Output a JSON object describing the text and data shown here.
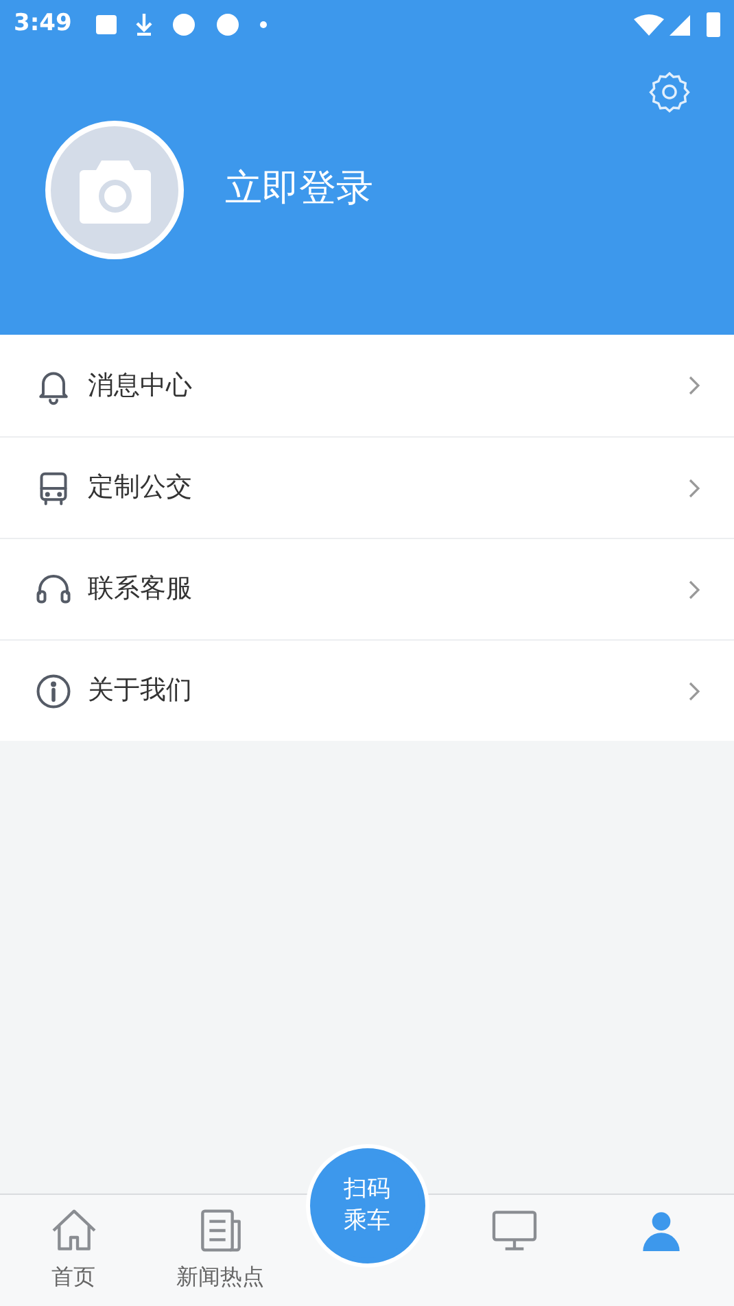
{
  "status_bar": {
    "time": "3:49"
  },
  "profile": {
    "login_label": "立即登录"
  },
  "menu": [
    {
      "kind": "bell",
      "label": "消息中心"
    },
    {
      "kind": "bus",
      "label": "定制公交"
    },
    {
      "kind": "headset",
      "label": "联系客服"
    },
    {
      "kind": "info",
      "label": "关于我们"
    }
  ],
  "tab_bar": {
    "tabs": [
      {
        "kind": "home",
        "label": "首页",
        "selected": false
      },
      {
        "kind": "news",
        "label": "新闻热点",
        "selected": false
      },
      {
        "kind": "scan",
        "label": "扫码乘车",
        "selected": false
      },
      {
        "kind": "screen",
        "selected": false
      },
      {
        "kind": "person",
        "selected": true
      }
    ]
  }
}
